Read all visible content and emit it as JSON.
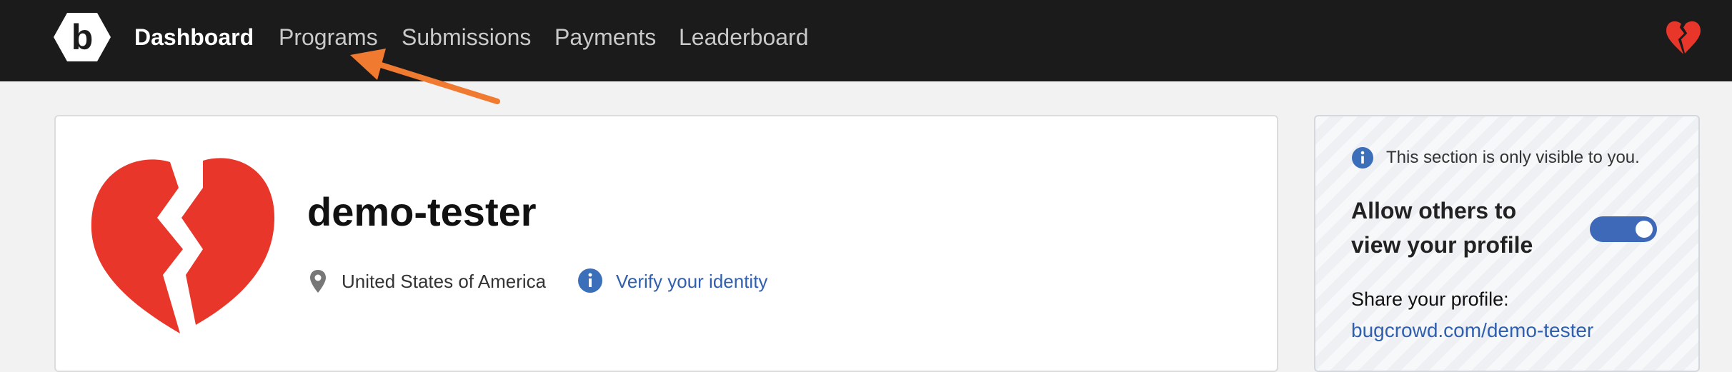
{
  "navbar": {
    "logo_letter": "b",
    "items": [
      {
        "label": "Dashboard",
        "active": true
      },
      {
        "label": "Programs",
        "active": false
      },
      {
        "label": "Submissions",
        "active": false
      },
      {
        "label": "Payments",
        "active": false
      },
      {
        "label": "Leaderboard",
        "active": false
      }
    ],
    "avatar_icon": "broken-heart-icon"
  },
  "annotation": {
    "icon": "arrow-icon",
    "color": "#f07a30"
  },
  "profile": {
    "username": "demo-tester",
    "location": "United States of America",
    "verify_link": "Verify your identity",
    "avatar_icon": "broken-heart-icon",
    "avatar_color": "#e8372a"
  },
  "privacy": {
    "note": "This section is only visible to you.",
    "toggle_label": "Allow others to view your profile",
    "toggle_on": true,
    "share_label": "Share your profile:",
    "share_link": "bugcrowd.com/demo-tester"
  },
  "colors": {
    "nav_bg": "#1b1b1b",
    "link": "#2f5fae",
    "toggle": "#3e69b8",
    "info_icon": "#3b6fba"
  }
}
